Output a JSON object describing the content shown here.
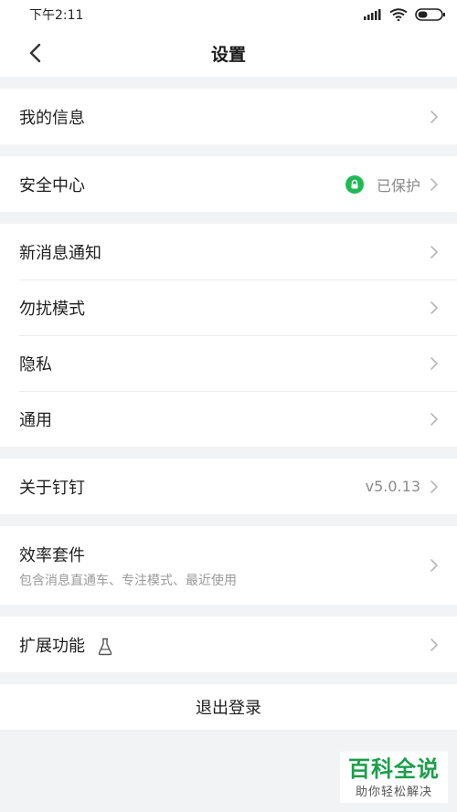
{
  "status_bar": {
    "time": "下午2:11"
  },
  "nav": {
    "title": "设置"
  },
  "groups": {
    "profile": {
      "label": "我的信息"
    },
    "security": {
      "label": "安全中心",
      "value": "已保护"
    },
    "general": {
      "items": [
        {
          "label": "新消息通知"
        },
        {
          "label": "勿扰模式"
        },
        {
          "label": "隐私"
        },
        {
          "label": "通用"
        }
      ]
    },
    "about": {
      "label": "关于钉钉",
      "value": "v5.0.13"
    },
    "efficiency": {
      "label": "效率套件",
      "subtitle": "包含消息直通车、专注模式、最近使用"
    },
    "extensions": {
      "label": "扩展功能"
    }
  },
  "logout": {
    "label": "退出登录"
  },
  "watermark": {
    "title": "百科全说",
    "subtitle": "助你轻松解决"
  },
  "colors": {
    "accent_green": "#1fba55",
    "background": "#f2f3f5",
    "watermark_green": "#1b9f4b"
  }
}
